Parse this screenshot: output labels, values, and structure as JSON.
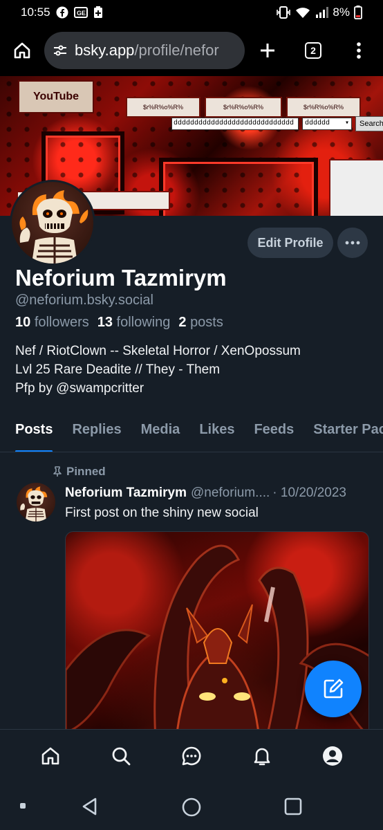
{
  "status_bar": {
    "time": "10:55",
    "battery": "8%"
  },
  "browser": {
    "url_host": "bsky.app",
    "url_path": "/profile/nefor",
    "tab_count": "2"
  },
  "banner": {
    "search_text": "ddddddddddddddddddddddddddddd",
    "select_value": "dddddd",
    "search_button": "Search",
    "logo_text": "YouTube"
  },
  "profile": {
    "display_name": "Neforium Tazmirym",
    "handle": "@neforium.bsky.social",
    "edit_label": "Edit Profile",
    "followers_count": "10",
    "followers_label": "followers",
    "following_count": "13",
    "following_label": "following",
    "posts_count": "2",
    "posts_label": "posts",
    "bio": [
      "Nef / RiotClown -- Skeletal Horror / XenOpossum",
      "Lvl 25 Rare Deadite // They - Them",
      "Pfp by @swampcritter"
    ]
  },
  "tabs": [
    "Posts",
    "Replies",
    "Media",
    "Likes",
    "Feeds",
    "Starter Pack"
  ],
  "post": {
    "pinned_label": "Pinned",
    "author_name": "Neforium Tazmirym",
    "author_handle": "@neforium....",
    "date": "· 10/20/2023",
    "text": "First post on the shiny new social"
  },
  "colors": {
    "accent": "#1083fe",
    "background": "#161e27",
    "muted": "#8c9aa9"
  }
}
